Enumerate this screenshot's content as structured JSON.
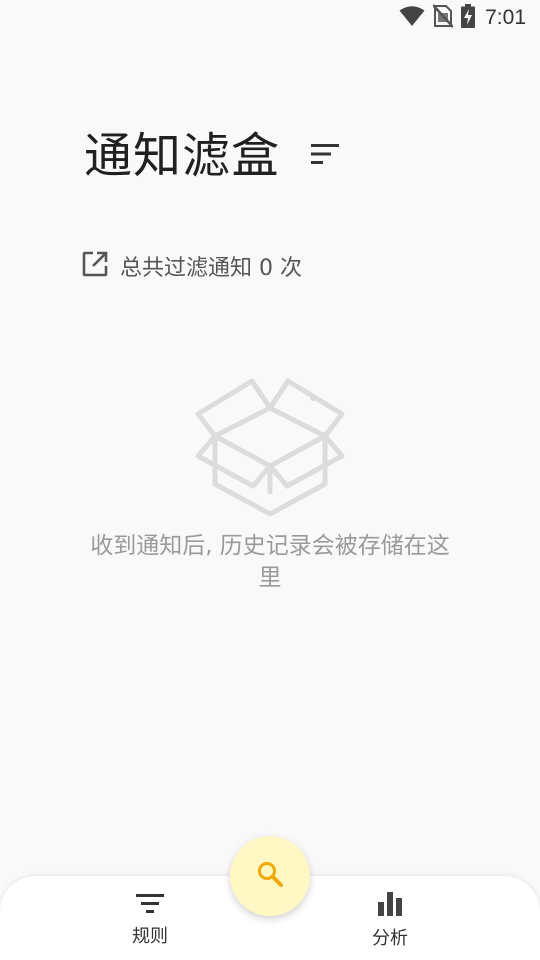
{
  "status_bar": {
    "time": "7:01",
    "icons": [
      "wifi-icon",
      "no-sim-icon",
      "battery-charging-icon"
    ]
  },
  "header": {
    "title": "通知滤盒",
    "sort_icon": "sort-icon"
  },
  "stats": {
    "icon": "open-in-new-icon",
    "text": "总共过滤通知 0 次"
  },
  "empty_state": {
    "icon": "empty-box-icon",
    "message": "收到通知后, 历史记录会被存储在这里"
  },
  "fab": {
    "icon": "search-icon",
    "color": "#fff7c4",
    "icon_color": "#f2a900"
  },
  "bottom_nav": {
    "items": [
      {
        "label": "规则",
        "icon": "filter-list-icon"
      },
      {
        "label": "分析",
        "icon": "bar-chart-icon"
      }
    ]
  }
}
